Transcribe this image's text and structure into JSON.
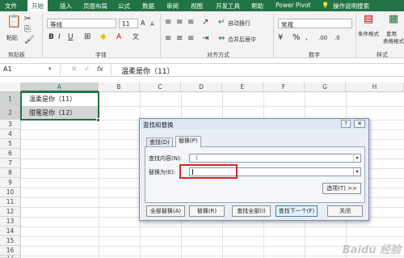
{
  "ribbon_tabs": [
    {
      "label": "文件",
      "active": false
    },
    {
      "label": "开始",
      "active": true
    },
    {
      "label": "插入",
      "active": false
    },
    {
      "label": "页面布局",
      "active": false
    },
    {
      "label": "公式",
      "active": false
    },
    {
      "label": "数据",
      "active": false
    },
    {
      "label": "审阅",
      "active": false
    },
    {
      "label": "视图",
      "active": false
    },
    {
      "label": "开发工具",
      "active": false
    },
    {
      "label": "帮助",
      "active": false
    },
    {
      "label": "Power Pivot",
      "active": false
    }
  ],
  "tell_me": "操作说明搜索",
  "ribbon": {
    "paste_label": "粘贴",
    "font_name": "等线",
    "font_size": "11",
    "wrap_text": "自动换行",
    "merge_center": "合并后居中",
    "number_format": "常规",
    "conditional_format": "条件格式",
    "table_format": "套用\n表格格式",
    "groups": {
      "clipboard": "剪贴板",
      "font": "字体",
      "alignment": "对齐方式",
      "number": "数字",
      "styles": "样式"
    }
  },
  "formula_bar": {
    "name_box": "A1",
    "fx": "fx",
    "content": "温柔是你（11）"
  },
  "columns": [
    "A",
    "B",
    "C",
    "D",
    "E",
    "F",
    "G",
    "H"
  ],
  "rows": [
    "1",
    "2",
    "3",
    "4",
    "5",
    "6",
    "7",
    "8",
    "9",
    "10",
    "11",
    "12",
    "13",
    "14",
    "15",
    "16",
    "17"
  ],
  "cells": {
    "a1": "温柔是你（11）",
    "a2": "甜蜜是你（12）"
  },
  "dialog": {
    "title": "查找和替换",
    "help": "?",
    "close": "✕",
    "tabs": [
      {
        "label": "查找(D)",
        "active": false
      },
      {
        "label": "替换(P)",
        "active": true
      }
    ],
    "find_label": "查找内容(N):",
    "find_value": "（",
    "replace_label": "替换为(E):",
    "replace_value": "",
    "options_button": "选项(T) >>",
    "buttons": {
      "replace_all": "全部替换(A)",
      "replace": "替换(R)",
      "find_all": "查找全部(I)",
      "find_next": "查找下一个(F)",
      "close": "关闭"
    }
  },
  "watermark": "Baidu 经验",
  "colors": {
    "excel_green": "#217346",
    "highlight_red": "#d9262b"
  }
}
